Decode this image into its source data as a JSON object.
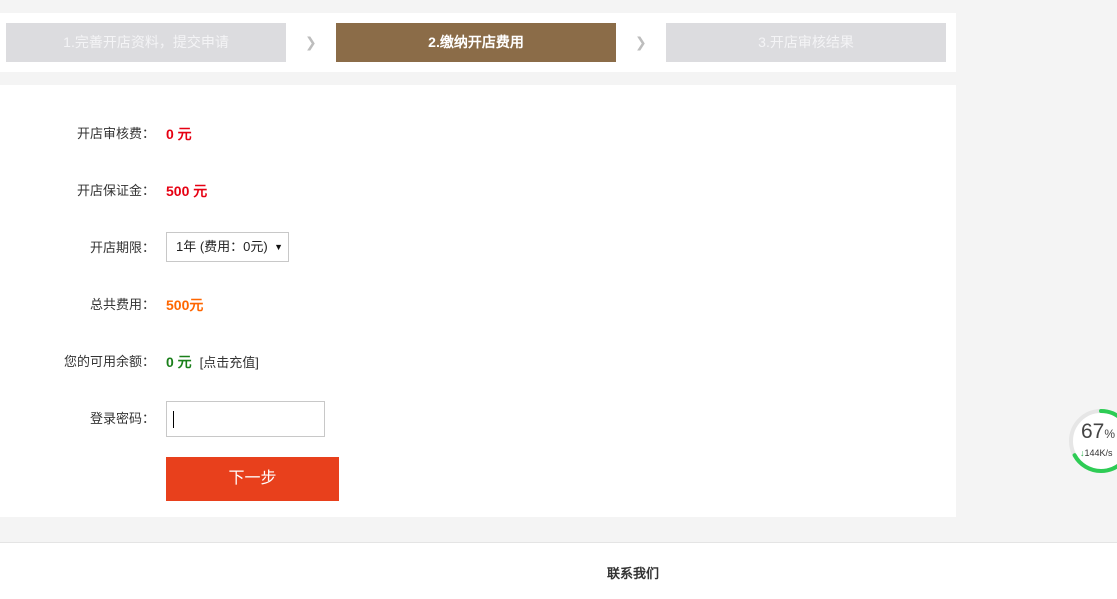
{
  "steps": [
    {
      "label": "1.完善开店资料，提交申请",
      "state": "done"
    },
    {
      "label": "2.缴纳开店费用",
      "state": "active"
    },
    {
      "label": "3.开店审核结果",
      "state": "pending"
    }
  ],
  "step_arrow": "❯",
  "form": {
    "audit_fee": {
      "label": "开店审核费：",
      "value": "0 元"
    },
    "deposit": {
      "label": "开店保证金：",
      "value": "500 元"
    },
    "period": {
      "label": "开店期限：",
      "selected": "1年 (费用：0元)"
    },
    "total": {
      "label": "总共费用：",
      "value": "500元"
    },
    "balance": {
      "label": "您的可用余额：",
      "value": "0 元",
      "recharge_link": "[点击充值]"
    },
    "password": {
      "label": "登录密码：",
      "value": ""
    },
    "next_button": "下一步"
  },
  "footer": {
    "contact": "联系我们"
  },
  "speed_widget": {
    "percent": "67",
    "percent_unit": "%",
    "speed": "144K/s",
    "down_arrow": "↓"
  },
  "colors": {
    "active_step": "#8b6c48",
    "inactive_step": "#dcdcdf",
    "red_value": "#e60012",
    "orange_value": "#ff6600",
    "green_value": "#1a7f1a",
    "next_button": "#e8401c",
    "widget_ring": "#2ecc55"
  }
}
